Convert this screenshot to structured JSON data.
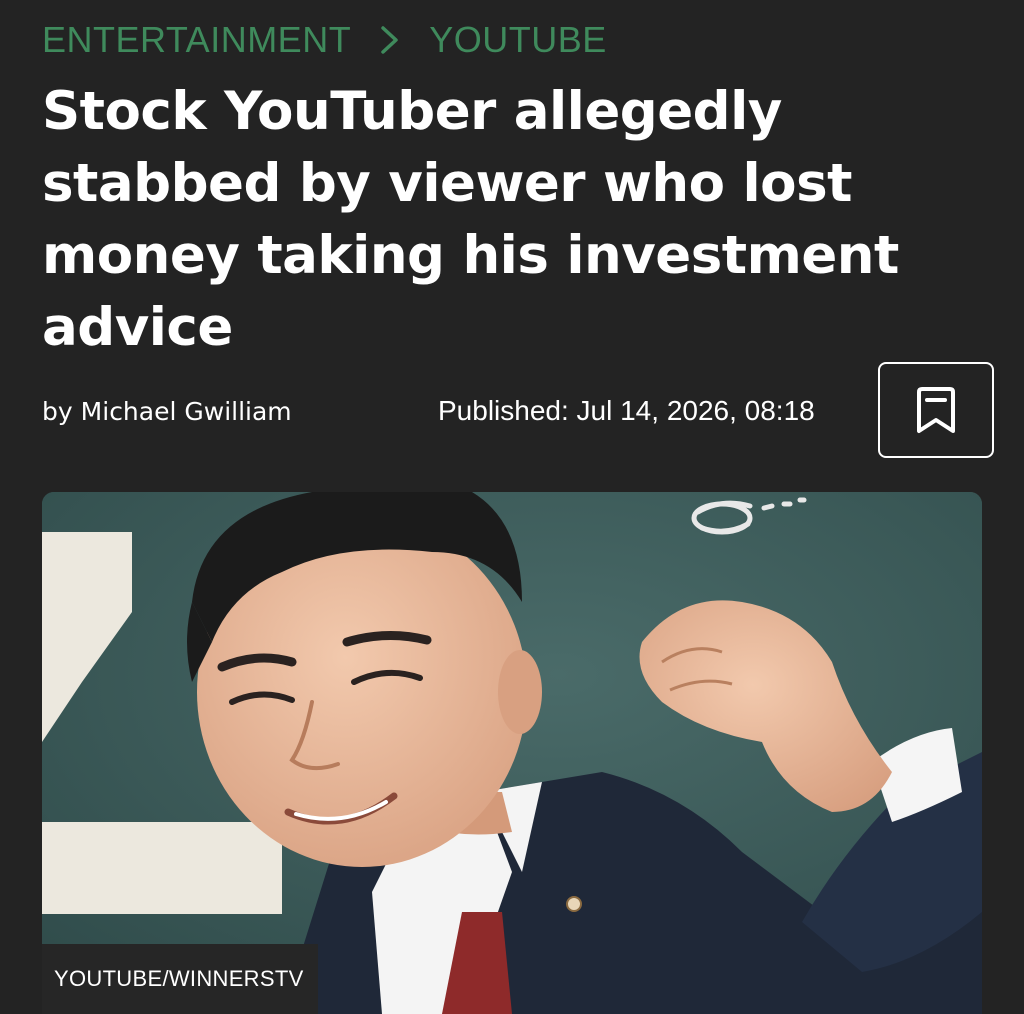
{
  "breadcrumb": {
    "category": "ENTERTAINMENT",
    "subcategory": "YOUTUBE",
    "separator_icon": "chevron-right-icon"
  },
  "article": {
    "headline": "Stock YouTuber allegedly stabbed by viewer who lost money taking his investment advice",
    "byline_prefix": "by",
    "author": "Michael Gwilliam",
    "published": "Published: Jul 14, 2026, 08:18",
    "bookmark_icon": "bookmark-icon"
  },
  "hero_image": {
    "credit": "YOUTUBE/WINNERSTV"
  },
  "colors": {
    "background": "#232323",
    "breadcrumb_accent": "#3f8a5c",
    "text": "#ffffff",
    "photo_backdrop": "#3e5c5a"
  }
}
